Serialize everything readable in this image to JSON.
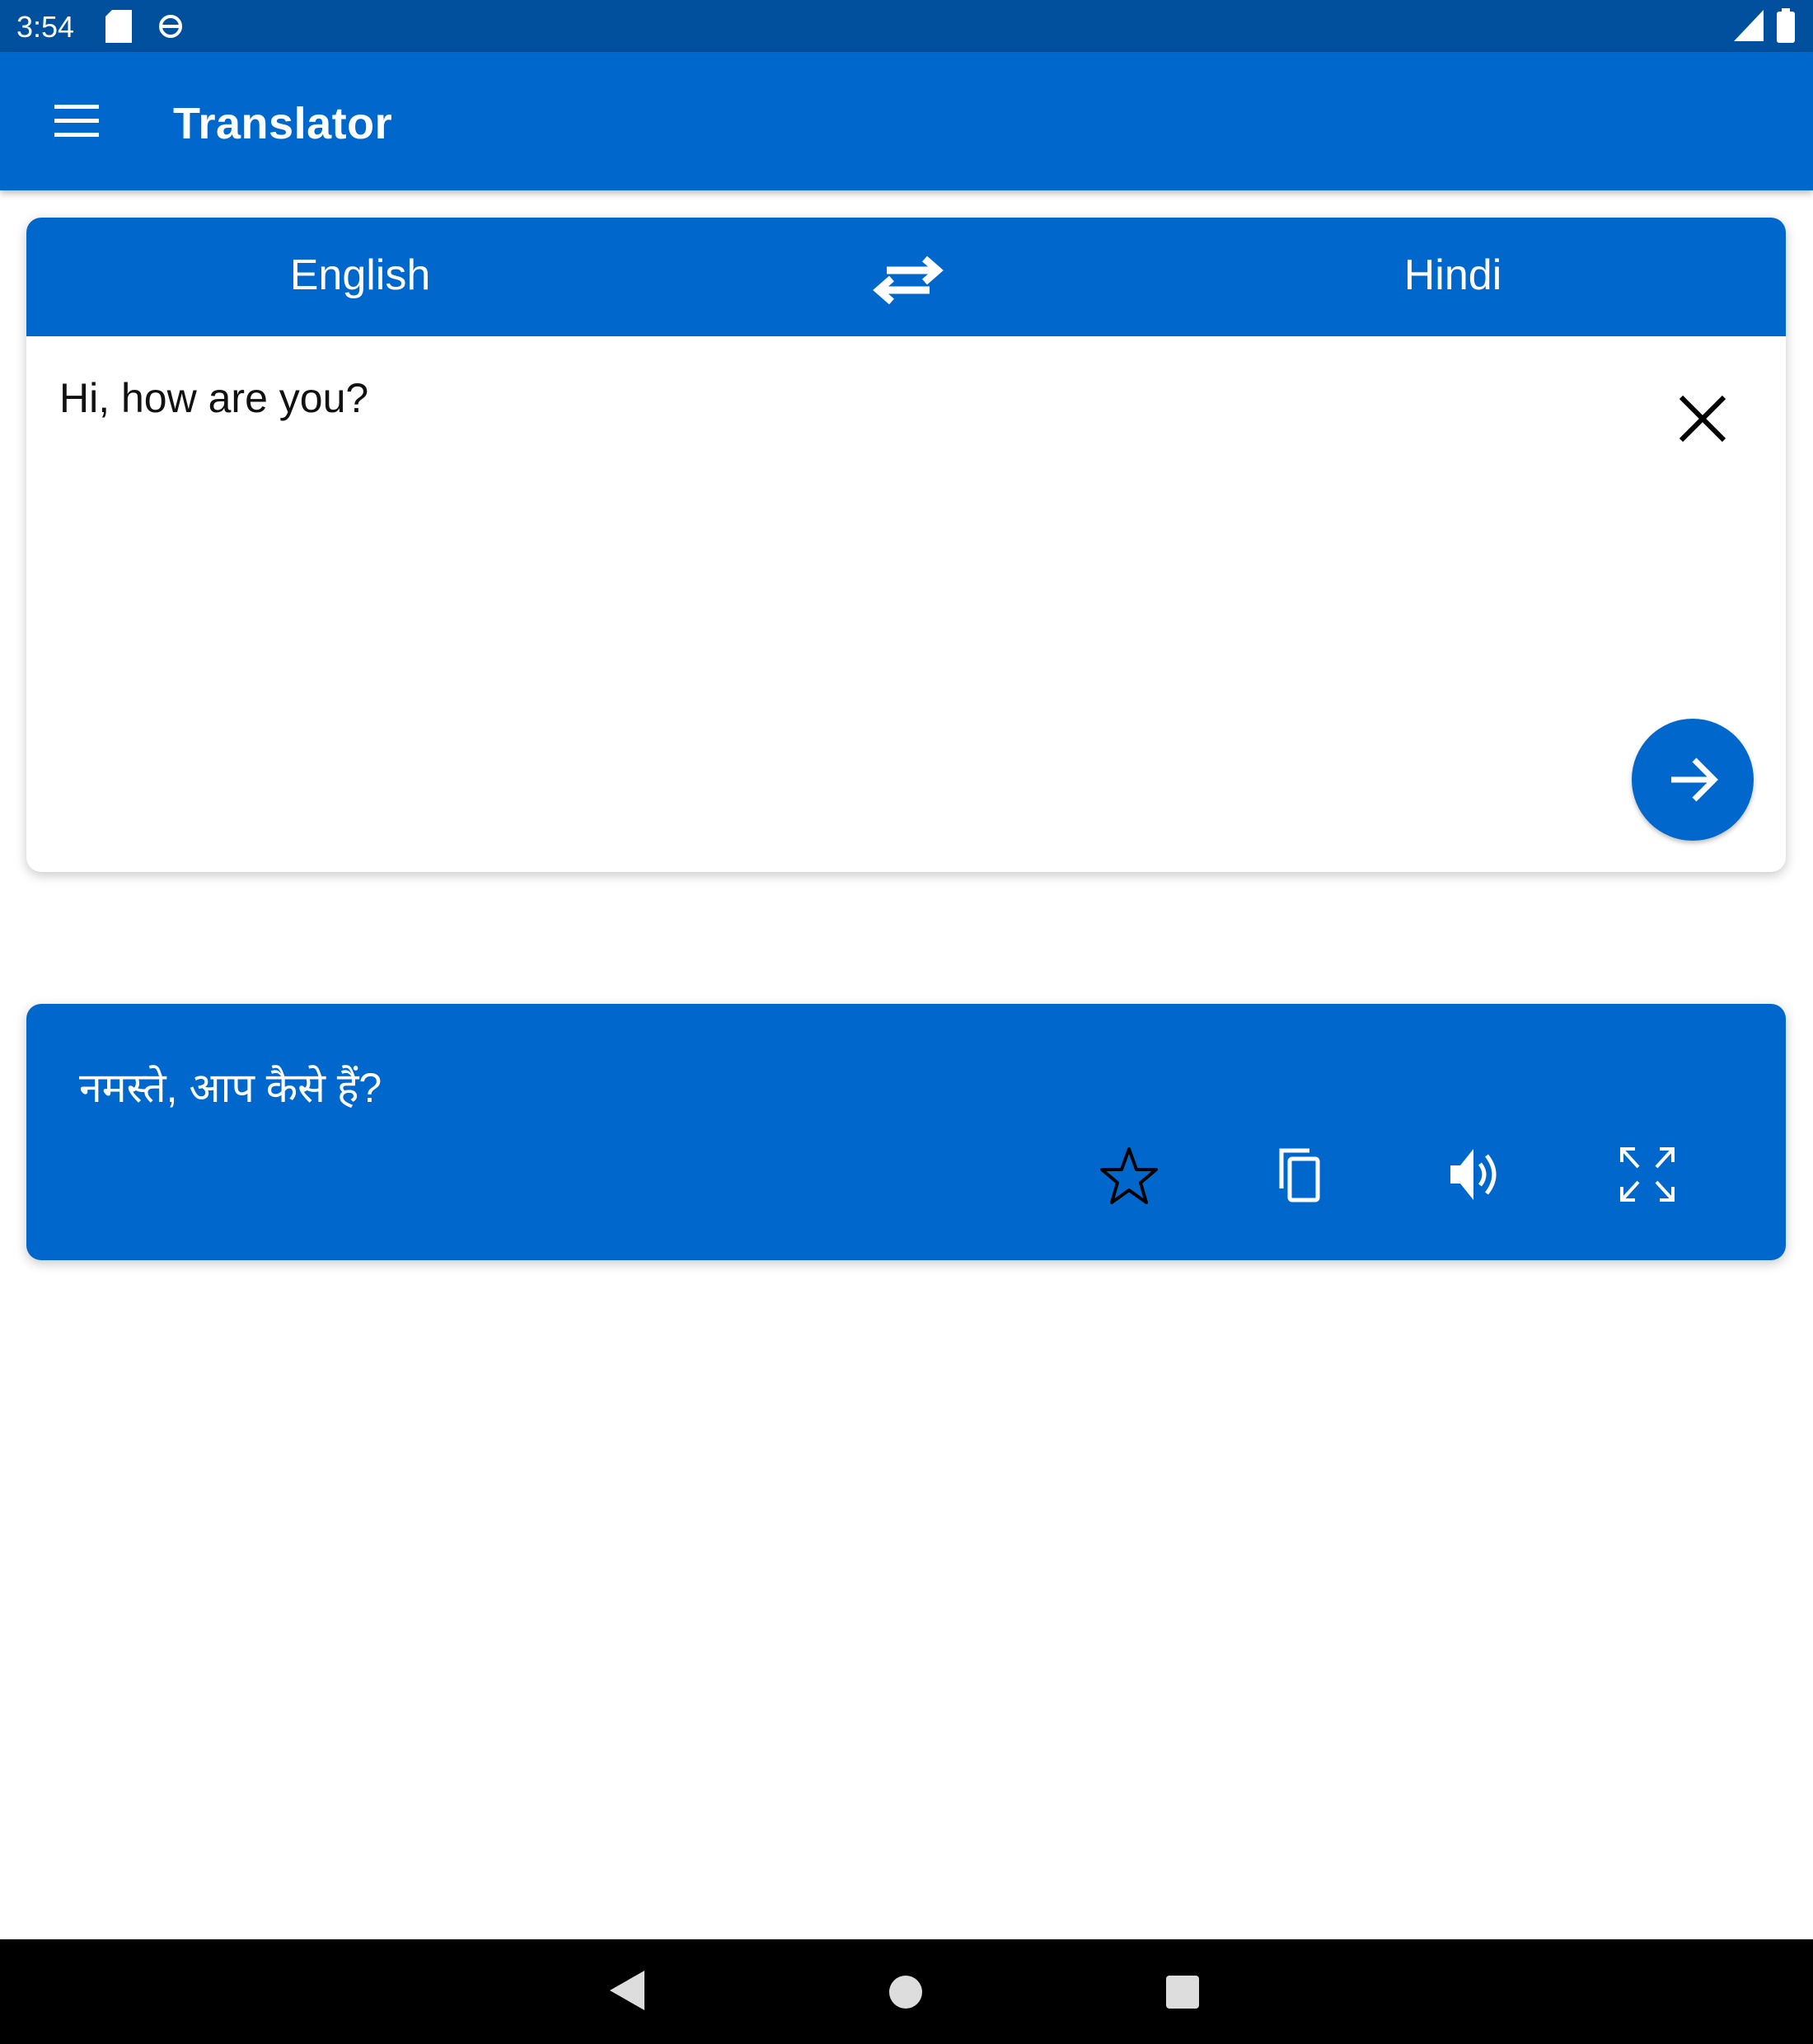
{
  "status_bar": {
    "time": "3:54",
    "icons": [
      "sd-card-icon",
      "sync-icon",
      "signal-icon",
      "battery-icon"
    ]
  },
  "app_bar": {
    "title": "Translator",
    "menu_icon": "hamburger-menu-icon"
  },
  "language_bar": {
    "source": "English",
    "target": "Hindi",
    "swap_icon": "swap-arrows-icon"
  },
  "input": {
    "value": "Hi, how are you?",
    "clear_icon": "close-icon",
    "translate_icon": "arrow-right-icon"
  },
  "output": {
    "text": "नमस्ते, आप कैसे हैं?",
    "actions": [
      "star-icon",
      "copy-icon",
      "speaker-icon",
      "fullscreen-icon"
    ]
  },
  "colors": {
    "primary": "#0067cd",
    "status_bar": "#00509e"
  }
}
